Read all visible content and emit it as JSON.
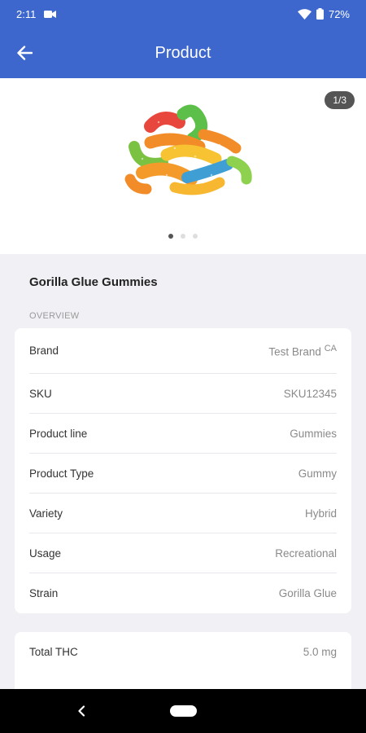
{
  "status_bar": {
    "time": "2:11",
    "battery": "72%",
    "icons": [
      "camera-icon",
      "wifi-icon",
      "battery-icon"
    ]
  },
  "app_bar": {
    "title": "Product",
    "back_icon": "arrow-back-icon"
  },
  "gallery": {
    "counter": "1/3",
    "image": "gummy-worms-product-image",
    "page_count": 3,
    "active_page": 1
  },
  "product": {
    "name": "Gorilla Glue Gummies",
    "overview_label": "OVERVIEW",
    "overview": [
      {
        "label": "Brand",
        "value": "Test Brand",
        "superscript": "CA"
      },
      {
        "label": "SKU",
        "value": "SKU12345"
      },
      {
        "label": "Product line",
        "value": "Gummies"
      },
      {
        "label": "Product Type",
        "value": "Gummy"
      },
      {
        "label": "Variety",
        "value": "Hybrid"
      },
      {
        "label": "Usage",
        "value": "Recreational"
      },
      {
        "label": "Strain",
        "value": "Gorilla Glue"
      }
    ],
    "potency": [
      {
        "label": "Total THC",
        "value": "5.0 mg"
      }
    ]
  },
  "colors": {
    "primary": "#3d67cc",
    "background": "#f1f1f5"
  }
}
